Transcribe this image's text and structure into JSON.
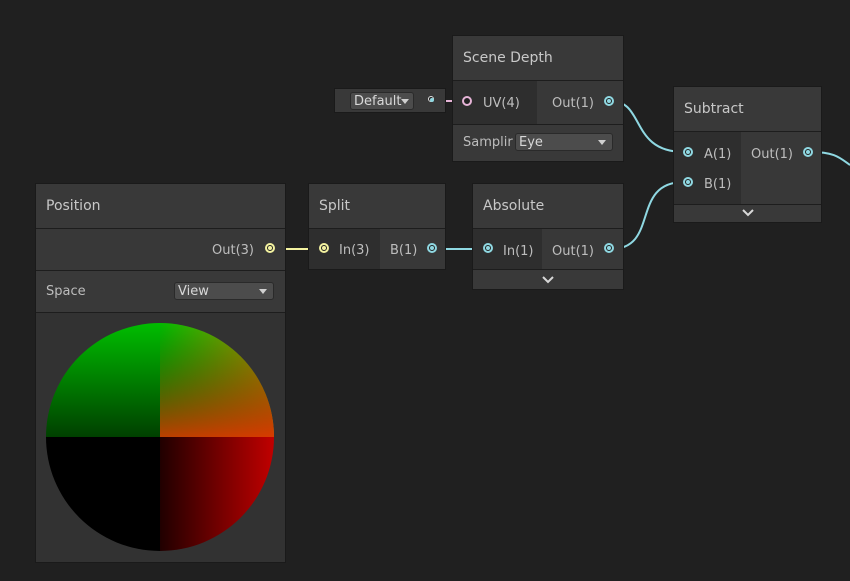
{
  "colors": {
    "background": "#202020",
    "node": "#393939",
    "wire_float": "#8fd8e2",
    "wire_vec3": "#f3f2a0",
    "wire_uv": "#e6b4d7"
  },
  "scene_depth": {
    "title": "Scene Depth",
    "input_label": "UV(4)",
    "output_label": "Out(1)",
    "uv_default_value": "Default",
    "sampling_label": "Samplir",
    "sampling_value": "Eye"
  },
  "subtract": {
    "title": "Subtract",
    "input_a_label": "A(1)",
    "input_b_label": "B(1)",
    "output_label": "Out(1)",
    "expand_icon": "chevron-down-icon"
  },
  "position": {
    "title": "Position",
    "output_label": "Out(3)",
    "space_label": "Space",
    "space_value": "View"
  },
  "split": {
    "title": "Split",
    "input_label": "In(3)",
    "output_label": "B(1)"
  },
  "absolute": {
    "title": "Absolute",
    "input_label": "In(1)",
    "output_label": "Out(1)",
    "expand_icon": "chevron-down-icon"
  }
}
